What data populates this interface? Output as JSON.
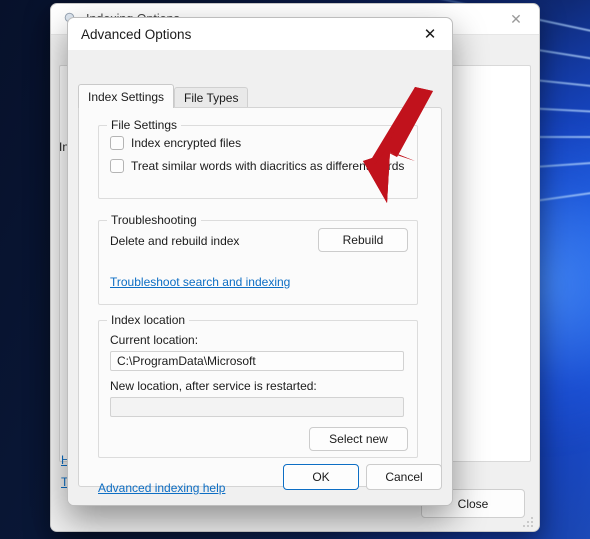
{
  "desktop": {
    "wallpaper_name": "windows-11-bloom-wallpaper",
    "accent_color": "#2f74ff"
  },
  "background_window": {
    "title": "Indexing Options",
    "icon": "indexing-options-icon",
    "close_icon": "close-icon",
    "fragments": {
      "label_in": "In",
      "link_h": "H",
      "link_t": "T"
    },
    "close_button_label": "Close",
    "resize_grip": "resize-grip"
  },
  "dialog": {
    "title": "Advanced Options",
    "close_icon": "close-icon",
    "tabs": [
      {
        "label": "Index Settings",
        "active": true
      },
      {
        "label": "File Types",
        "active": false
      }
    ],
    "file_settings": {
      "legend": "File Settings",
      "checkboxes": [
        {
          "label": "Index encrypted files",
          "checked": false
        },
        {
          "label": "Treat similar words with diacritics as different words",
          "checked": false
        }
      ]
    },
    "troubleshooting": {
      "legend": "Troubleshooting",
      "rebuild_label": "Delete and rebuild index",
      "rebuild_button": "Rebuild",
      "link": "Troubleshoot search and indexing"
    },
    "index_location": {
      "legend": "Index location",
      "current_label": "Current location:",
      "current_value": "C:\\ProgramData\\Microsoft",
      "new_label": "New location, after service is restarted:",
      "new_value": "",
      "new_placeholder": "",
      "select_new_button": "Select new"
    },
    "help_link": "Advanced indexing help",
    "ok_button": "OK",
    "cancel_button": "Cancel"
  },
  "annotation": {
    "arrow_color": "#c1121c",
    "arrow_name": "red-arrow-pointing-to-rebuild-button"
  }
}
